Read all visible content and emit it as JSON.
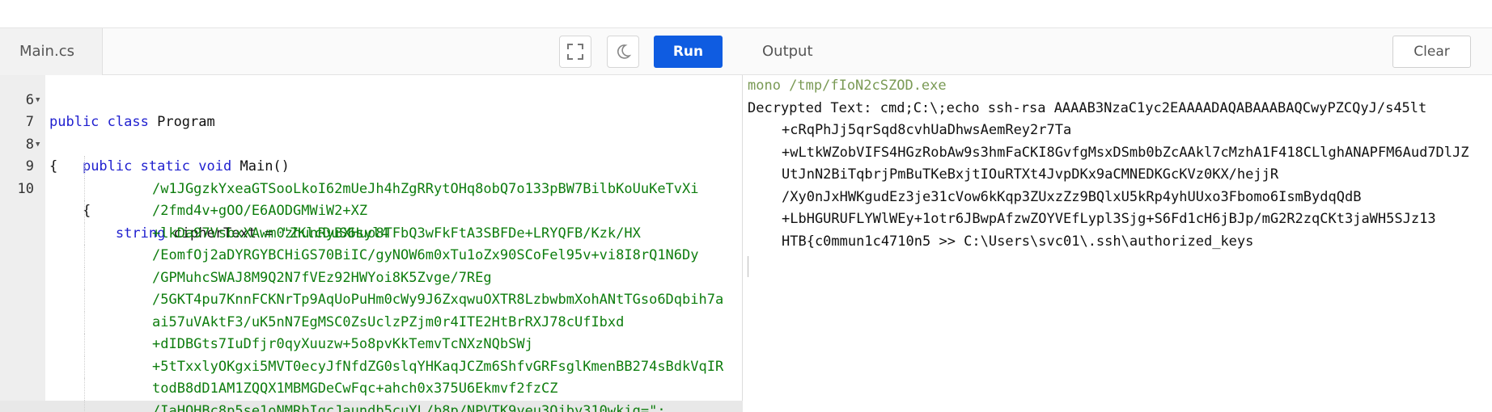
{
  "editor": {
    "file_tab": "Main.cs",
    "run_label": "Run",
    "lines": [
      {
        "num": "6",
        "fold": false,
        "text": "public class Program",
        "tokens": [
          {
            "t": "kw",
            "v": "public"
          },
          {
            "t": "",
            "v": " "
          },
          {
            "t": "kw",
            "v": "class"
          },
          {
            "t": "",
            "v": " Program"
          }
        ]
      },
      {
        "num": "7",
        "fold": true,
        "text": "{"
      },
      {
        "num": "8",
        "fold": false,
        "text": "    public static void Main()"
      },
      {
        "num": "9",
        "fold": true,
        "text": "    {"
      },
      {
        "num": "10",
        "fold": false,
        "text": "        string cipherText = \"ZKlcDuS6syl4"
      }
    ],
    "string_continuation": [
      "/w1JGgzkYxeaGTSooLkoI62mUeJh4hZgRRytOHq8obQ7o133pBW7BilbKoUuKeTvXi",
      "/2fmd4v+gOO/E6AODGMWiW2+XZ",
      "+lkDa97VsbxXAwm0zhunRyBXHuo8TFbQ3wFkFtA3SBFDe+LRYQFB/Kzk/HX",
      "/EomfOj2aDYRGYBCHiGS70BiIC/gyNOW6m0xTu1oZx90SCoFel95v+vi8I8rQ1N6Dy",
      "/GPMuhcSWAJ8M9Q2N7fVEz92HWYoi8K5Zvge/7REg",
      "/5GKT4pu7KnnFCKNrTp9AqUoPuHm0cWy9J6ZxqwuOXTR8LzbwbmXohANtTGso6Dqbih7a",
      "ai57uVAktF3/uK5nN7EgMSC0ZsUclzPZjm0r4ITE2HtBrRXJ78cUfIbxd",
      "+dIDBGts7IuDfjr0qyXuuzw+5o8pvKkTemvTcNXzNQbSWj",
      "+5tTxxlyOKgxi5MVT0ecyJfNfdZG0slqYHKaqJCZm6ShfvGRFsglKmenBB274sBdkVqIR",
      "todB8dD1AM1ZQQX1MBMGDeCwFqc+ahch0x375U6Ekmvf2fzCZ",
      "/IaHOHBc8p5se1oNMRbIgcJaundb5cuYL/b8p/NPVTK9yeu3Qjby310wkig=\";"
    ]
  },
  "output": {
    "title": "Output",
    "clear_label": "Clear",
    "lines": [
      "mono /tmp/fIoN2cSZOD.exe",
      "Decrypted Text: cmd;C:\\;echo ssh-rsa AAAAB3NzaC1yc2EAAAADAQABAAABAQCwyPZCQyJ/s45lt",
      "+cRqPhJj5qrSqd8cvhUaDhwsAemRey2r7Ta",
      "+wLtkWZobVIFS4HGzRobAw9s3hmFaCKI8GvfgMsxDSmb0bZcAAkl7cMzhA1F418CLlghANAPFM6Aud7DlJZ",
      "UtJnN2BiTqbrjPmBuTKeBxjtIOuRTXt4JvpDKx9aCMNEDKGcKVz0KX/hejjR",
      "/Xy0nJxHWKgudEz3je31cVow6kKqp3ZUxzZz9BQlxU5kRp4yhUUxo3Fbomo6IsmBydqQdB",
      "+LbHGURUFLYWlWEy+1otr6JBwpAfzwZOYVEfLypl3Sjg+S6Fd1cH6jBJp/mG2R2zqCKt3jaWH5SJz13",
      "HTB{c0mmun1c4710n5 >> C:\\Users\\svc01\\.ssh\\authorized_keys"
    ]
  }
}
